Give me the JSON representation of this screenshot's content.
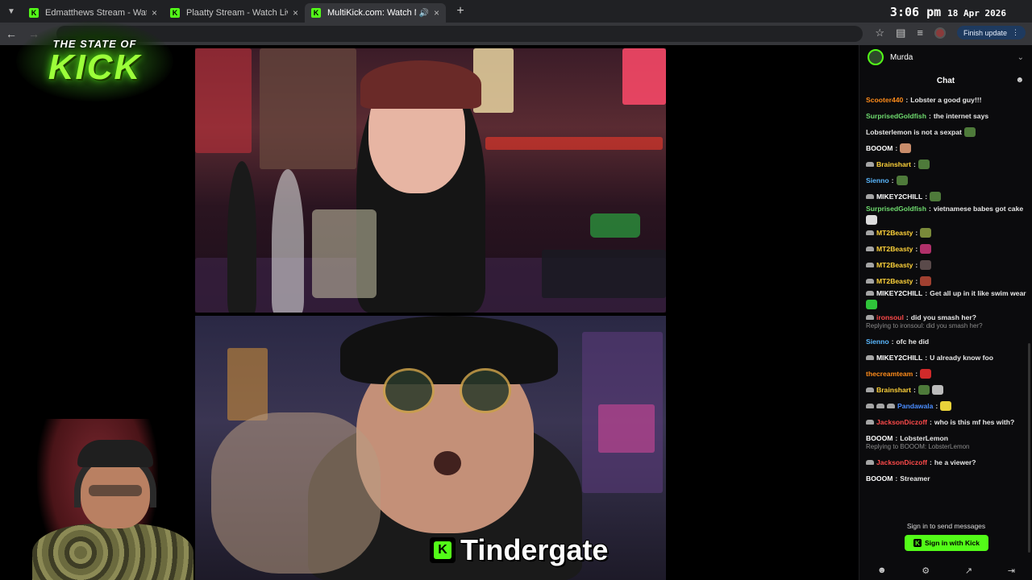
{
  "browser": {
    "tabs": [
      {
        "title": "Edmatthews Stream - Watch Li",
        "active": false
      },
      {
        "title": "Plaatty Stream - Watch Live on",
        "active": false
      },
      {
        "title": "MultiKick.com: Watch Multi",
        "active": true
      }
    ],
    "new_tab_label": "+",
    "update_button": "Finish update",
    "clock_time": "3:06 pm",
    "clock_date": "18 Apr 2026"
  },
  "overlay": {
    "logo_top": "THE STATE OF",
    "logo_main": "KICK",
    "caption": "Tindergate",
    "caption_icon": "K"
  },
  "chat": {
    "channel": "Murda",
    "header": "Chat",
    "messages": [
      {
        "user": "Scooter440",
        "color": "#ff8c1a",
        "text": "Lobster a good guy!!!",
        "badges": 0,
        "emotes": []
      },
      {
        "user": "SurprisedGoldfish",
        "color": "#6fdc6f",
        "text": "the internet says",
        "badges": 0,
        "emotes": []
      },
      {
        "user": "",
        "color": "#ffffff",
        "text": "Lobsterlemon is not a sexpat",
        "badges": 0,
        "emotes": [
          "#4e7a3a"
        ]
      },
      {
        "user": "BOOOM",
        "color": "#ffffff",
        "text": "",
        "badges": 0,
        "emotes": [
          "#c98c6a"
        ]
      },
      {
        "user": "Brainshart",
        "color": "#ffd23a",
        "text": "",
        "badges": 1,
        "emotes": [
          "#4e7a3a"
        ]
      },
      {
        "user": "Sienno",
        "color": "#5ab8ff",
        "text": "",
        "badges": 0,
        "emotes": [
          "#4e7a3a"
        ]
      },
      {
        "user": "MIKEY2CHILL",
        "color": "#ffffff",
        "text": "",
        "badges": 1,
        "emotes": [
          "#4e7a3a"
        ]
      },
      {
        "user": "SurprisedGoldfish",
        "color": "#6fdc6f",
        "text": "vietnamese babes got cake",
        "badges": 0,
        "emotes": [
          "#dddddd"
        ]
      },
      {
        "user": "MT2Beasty",
        "color": "#ffd23a",
        "text": "",
        "badges": 1,
        "emotes": [
          "#7a8a3a"
        ]
      },
      {
        "user": "MT2Beasty",
        "color": "#ffd23a",
        "text": "",
        "badges": 1,
        "emotes": [
          "#b0306a"
        ]
      },
      {
        "user": "MT2Beasty",
        "color": "#ffd23a",
        "text": "",
        "badges": 1,
        "emotes": [
          "#5a4a4a"
        ]
      },
      {
        "user": "MT2Beasty",
        "color": "#ffd23a",
        "text": "",
        "badges": 1,
        "emotes": [
          "#a04030"
        ]
      },
      {
        "user": "MIKEY2CHILL",
        "color": "#ffffff",
        "text": "Get all up in it like swim wear",
        "badges": 1,
        "emotes": [
          "#2fc43a"
        ]
      },
      {
        "user": "ironsoul",
        "color": "#ff4a4a",
        "text": "did you smash her?",
        "badges": 1,
        "emotes": []
      },
      {
        "reply": "Replying to ironsoul: did you smash her?"
      },
      {
        "user": "Sienno",
        "color": "#5ab8ff",
        "text": "ofc he did",
        "badges": 0,
        "emotes": []
      },
      {
        "user": "MIKEY2CHILL",
        "color": "#ffffff",
        "text": "U already know foo",
        "badges": 1,
        "emotes": []
      },
      {
        "user": "thecreamteam",
        "color": "#ff8c1a",
        "text": "",
        "badges": 0,
        "emotes": [
          "#d02a2a"
        ]
      },
      {
        "user": "Brainshart",
        "color": "#ffd23a",
        "text": "",
        "badges": 1,
        "emotes": [
          "#4e7a3a",
          "#bbbbbb"
        ]
      },
      {
        "user": "Pandawala",
        "color": "#4a8cff",
        "text": "",
        "badges": 3,
        "emotes": [
          "#e8d23a"
        ]
      },
      {
        "user": "JacksonDiczoff",
        "color": "#ff4a4a",
        "text": "who is this mf hes with?",
        "badges": 1,
        "emotes": []
      },
      {
        "user": "BOOOM",
        "color": "#ffffff",
        "text": "LobsterLemon",
        "badges": 0,
        "emotes": []
      },
      {
        "reply": "Replying to BOOOM: LobsterLemon"
      },
      {
        "user": "JacksonDiczoff",
        "color": "#ff4a4a",
        "text": "he a viewer?",
        "badges": 1,
        "emotes": []
      },
      {
        "user": "BOOOM",
        "color": "#ffffff",
        "text": "Streamer",
        "badges": 0,
        "emotes": []
      }
    ],
    "signin_prompt": "Sign in to send messages",
    "signin_button": "Sign in with Kick"
  }
}
